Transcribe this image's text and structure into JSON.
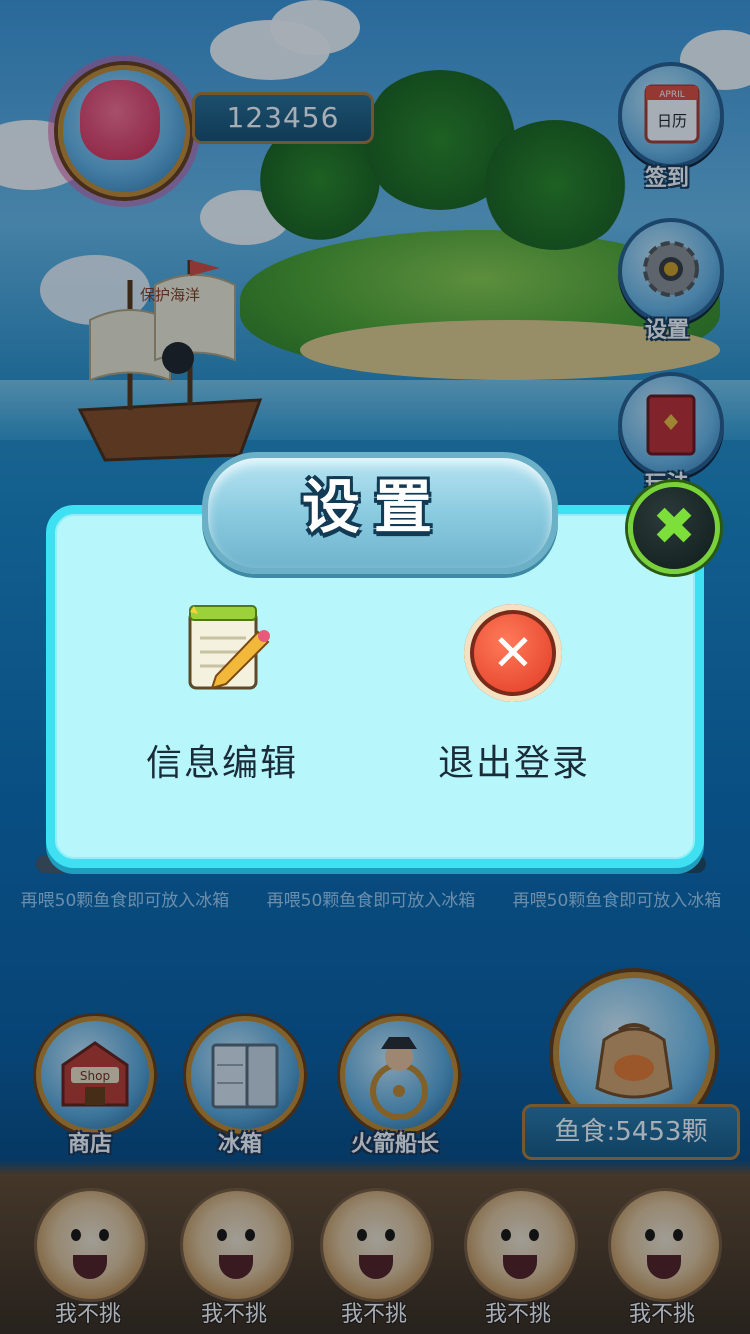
{
  "player": {
    "score": "123456"
  },
  "scene": {
    "ship_flag": "保护海洋"
  },
  "side_menu": [
    {
      "label": "签到",
      "icon": "calendar-icon",
      "calendar_text": "日历",
      "calendar_month": "APRIL"
    },
    {
      "label": "设置",
      "icon": "gear-icon"
    },
    {
      "label": "玩法",
      "icon": "book-icon"
    }
  ],
  "fish_hints": [
    {
      "text": "再喂50颗鱼食即可放入冰箱",
      "progress": 0.8,
      "color": "#4a5a68"
    },
    {
      "text": "再喂50颗鱼食即可放入冰箱",
      "progress": 0.8,
      "color": "#e43a2a"
    },
    {
      "text": "再喂50颗鱼食即可放入冰箱",
      "progress": 0.8,
      "color": "#4a5a68"
    }
  ],
  "bottom_menu": [
    {
      "label": "商店",
      "icon": "shop-icon",
      "sign": "Shop"
    },
    {
      "label": "冰箱",
      "icon": "fridge-icon"
    },
    {
      "label": "火箭船长",
      "icon": "captain-icon"
    }
  ],
  "fish_food": {
    "label": "鱼食:5453颗",
    "icon": "fish-food-bag-icon"
  },
  "friends": [
    {
      "name": "我不挑"
    },
    {
      "name": "我不挑"
    },
    {
      "name": "我不挑"
    },
    {
      "name": "我不挑"
    },
    {
      "name": "我不挑"
    }
  ],
  "settings_dialog": {
    "title": "设置",
    "close_icon": "close-icon",
    "options": [
      {
        "label": "信息编辑",
        "icon": "edit-note-icon"
      },
      {
        "label": "退出登录",
        "icon": "logout-x-icon"
      }
    ]
  },
  "colors": {
    "panel_bg": "#b7f7fb",
    "panel_border": "#3fe0f2",
    "close_green": "#7ad23a"
  }
}
